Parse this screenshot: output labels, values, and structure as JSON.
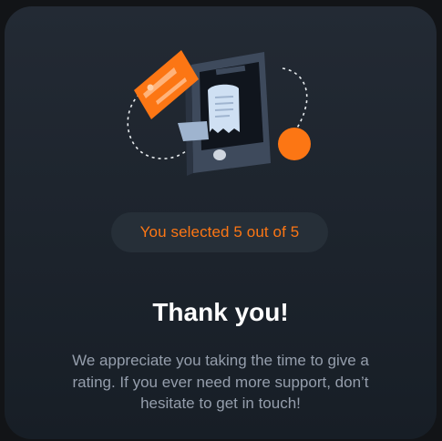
{
  "card": {
    "badge_text": "You selected 5 out of 5",
    "title": "Thank you!",
    "message": "We appreciate you taking the time to give a rating. If you ever need more support, don’t hesitate to get in touch!"
  },
  "colors": {
    "page_background": "#121417",
    "card_background": "#1f262e",
    "accent": "#fc7614",
    "badge_background": "#262f38",
    "text_primary": "#ffffff",
    "text_secondary": "#959eac"
  },
  "icons": {
    "illustration": "phone-receipt-card-illustration"
  }
}
